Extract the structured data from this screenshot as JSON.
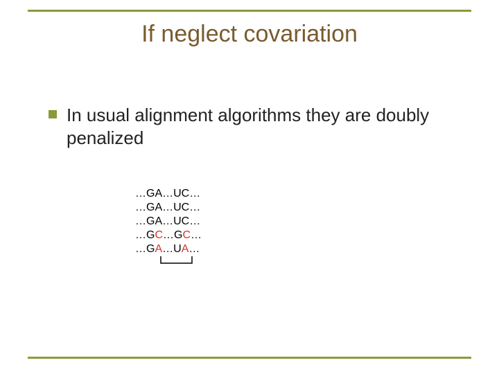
{
  "title": "If neglect covariation",
  "bullet": "In usual alignment algorithms they are doubly penalized",
  "sequences": [
    {
      "pre": "…GA…UC…"
    },
    {
      "pre": "…GA…UC…"
    },
    {
      "pre": "…GA…UC…"
    },
    {
      "a": "…G",
      "b": "C",
      "c": "…G",
      "d": "C",
      "e": "…"
    },
    {
      "a": "…G",
      "b": "A",
      "c": "…U",
      "d": "A",
      "e": "…"
    }
  ]
}
